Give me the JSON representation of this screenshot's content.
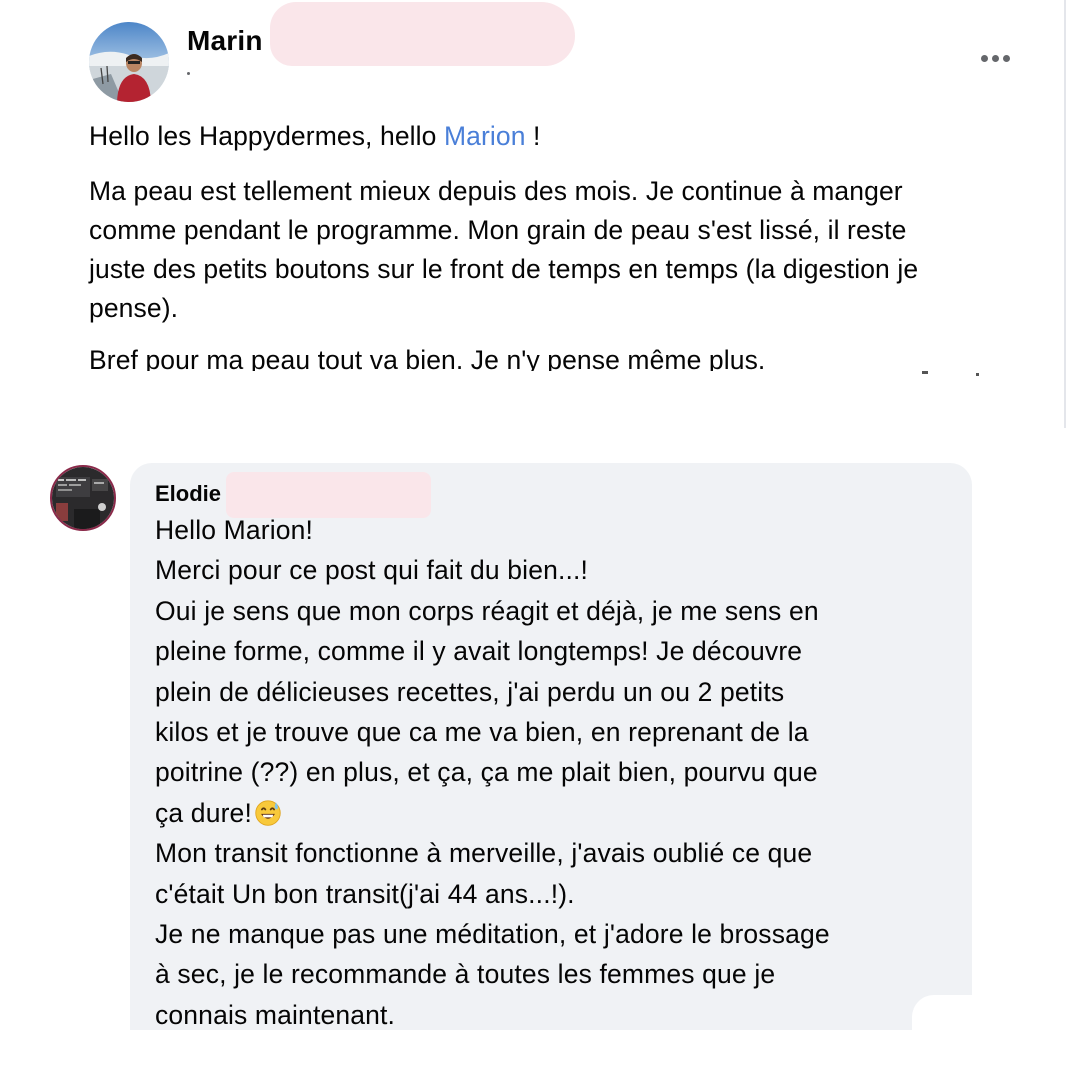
{
  "post": {
    "author_visible": "Marin",
    "greeting_prefix": "Hello les Happydermes, hello ",
    "greeting_mention": "Marion",
    "greeting_suffix": " !",
    "paragraph_2_lines": [
      "Ma peau est tellement mieux depuis des mois. Je continue à manger",
      "comme pendant le programme. Mon grain de peau s'est lissé, il reste",
      "juste des petits boutons sur le front de temps en temps (la digestion je",
      "pense)."
    ],
    "paragraph_3": "Bref pour ma peau tout va bien. Je n'y pense même plus.",
    "more_icon": "more-horizontal-icon"
  },
  "comment": {
    "author_visible": "Elodie",
    "lines": [
      "Hello Marion!",
      "Merci pour ce post qui fait du bien...!",
      "Oui je sens que mon corps réagit et déjà, je me sens en",
      "pleine forme, comme il y avait longtemps! Je découvre",
      "plein de délicieuses recettes, j'ai perdu un ou 2 petits",
      "kilos et je trouve que ca me va bien, en reprenant de la",
      "poitrine (??) en plus, et ça, ça me plait bien, pourvu que",
      "ça dure!",
      "Mon transit fonctionne à merveille, j'avais oublié ce que",
      "c'était Un bon transit(j'ai 44 ans...!).",
      "Je ne manque pas une méditation, et j'adore le brossage",
      "à sec, je le recommande à toutes les femmes que je",
      "connais maintenant."
    ],
    "emoji_icon": "grinning-sweat-emoji-icon"
  },
  "colors": {
    "mention": "#4a7fd8",
    "bubble": "#f0f2f5",
    "redaction": "#fae6ea",
    "text": "#050505"
  }
}
